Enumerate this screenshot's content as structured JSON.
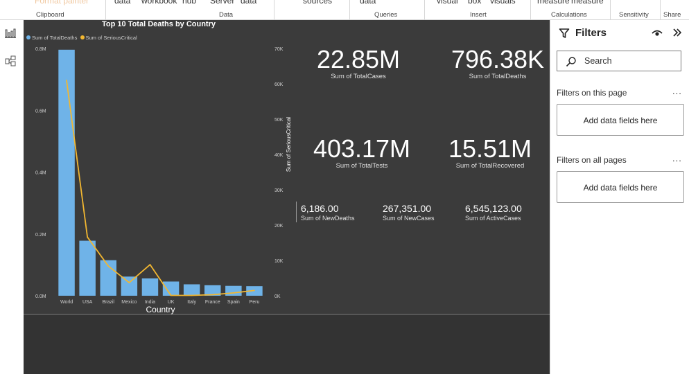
{
  "ribbon": {
    "top_items": [
      "Format painter",
      "data",
      "workbook",
      "hub",
      "Server",
      "data",
      "sources",
      "data",
      "visual",
      "box",
      "visuals",
      "measure",
      "measure"
    ],
    "groups": [
      "Clipboard",
      "Data",
      "Queries",
      "Insert",
      "Calculations",
      "Sensitivity",
      "Share"
    ]
  },
  "leftbar": {
    "icons": [
      "report-view-icon",
      "model-view-icon"
    ]
  },
  "chart": {
    "title": "Top 10 Total Deaths by Country",
    "legend": [
      "Sum of TotalDeaths",
      "Sum of SeriousCritical"
    ]
  },
  "chart_data": {
    "type": "bar",
    "title": "Top 10 Total Deaths by Country",
    "xlabel": "Country",
    "ylabel": "",
    "y2label": "Sum of SeriousCritical",
    "categories": [
      "World",
      "USA",
      "Brazil",
      "Mexico",
      "India",
      "UK",
      "Italy",
      "France",
      "Spain",
      "Peru"
    ],
    "ylim": [
      0,
      800000
    ],
    "y_ticks": [
      "0.0M",
      "0.2M",
      "0.4M",
      "0.6M",
      "0.8M"
    ],
    "y2lim": [
      0,
      70000
    ],
    "y2_ticks": [
      "0K",
      "10K",
      "20K",
      "30K",
      "40K",
      "50K",
      "60K",
      "70K"
    ],
    "series": [
      {
        "name": "Sum of TotalDeaths",
        "type": "bar",
        "color": "#6fb3e8",
        "values": [
          796000,
          178000,
          115000,
          62000,
          56000,
          46000,
          37000,
          34000,
          32000,
          31000
        ]
      },
      {
        "name": "Sum of SeriousCritical",
        "type": "line",
        "axis": "secondary",
        "color": "#f2b731",
        "values": [
          61000,
          16600,
          8400,
          3700,
          8800,
          100,
          100,
          300,
          800,
          1500
        ]
      }
    ],
    "grid": false,
    "legend_position": "top-left"
  },
  "kpis_big": [
    {
      "value": "22.85M",
      "label": "Sum of TotalCases"
    },
    {
      "value": "796.38K",
      "label": "Sum of TotalDeaths"
    },
    {
      "value": "403.17M",
      "label": "Sum of TotalTests"
    },
    {
      "value": "15.51M",
      "label": "Sum of TotalRecovered"
    }
  ],
  "kpis_small": [
    {
      "value": "6,186.00",
      "label": "Sum of NewDeaths"
    },
    {
      "value": "267,351.00",
      "label": "Sum of NewCases"
    },
    {
      "value": "6,545,123.00",
      "label": "Sum of ActiveCases"
    }
  ],
  "filters": {
    "title": "Filters",
    "search_placeholder": "Search",
    "this_page_label": "Filters on this page",
    "all_pages_label": "Filters on all pages",
    "drop_label": "Add data fields here",
    "more": "..."
  },
  "colors": {
    "canvas": "#3b3b3b",
    "bar": "#6fb3e8",
    "line": "#f2b731"
  }
}
